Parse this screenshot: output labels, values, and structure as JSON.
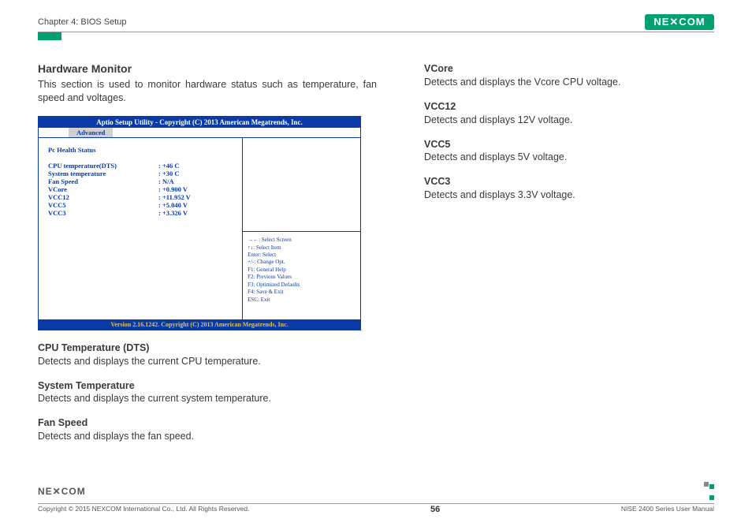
{
  "header": {
    "chapter": "Chapter 4: BIOS Setup",
    "brand": "NEXCOM"
  },
  "section": {
    "title": "Hardware Monitor",
    "intro": "This section is used to monitor hardware status such as temperature, fan speed and voltages."
  },
  "bios": {
    "title": "Aptio Setup Utility - Copyright (C) 2013 American Megatrends, Inc.",
    "tab": "Advanced",
    "heading": "Pc Health Status",
    "rows": [
      {
        "label": "CPU temperature(DTS)",
        "value": ":  +46 C"
      },
      {
        "label": "System temperature",
        "value": ":  +30 C"
      },
      {
        "label": "Fan Speed",
        "value": ":  N/A"
      },
      {
        "label": "VCore",
        "value": ":  +0.900 V"
      },
      {
        "label": "VCC12",
        "value": ":  +11.952 V"
      },
      {
        "label": "VCC5",
        "value": ":  +5.040 V"
      },
      {
        "label": "VCC3",
        "value": ":  +3.326 V"
      }
    ],
    "help": [
      "→←: Select Screen",
      "↑↓: Select Item",
      "Enter: Select",
      "+/-: Change Opt.",
      "F1: General Help",
      "F2: Previous Values",
      "F3: Optimized Defaults",
      "F4: Save & Exit",
      "ESC: Exit"
    ],
    "footer": "Version 2.16.1242. Copyright (C) 2013 American Megatrends, Inc."
  },
  "defs_left": [
    {
      "term": "CPU Temperature (DTS)",
      "desc": "Detects and displays the current CPU temperature."
    },
    {
      "term": "System Temperature",
      "desc": "Detects and displays the current system temperature."
    },
    {
      "term": "Fan Speed",
      "desc": "Detects and displays the fan speed."
    }
  ],
  "defs_right": [
    {
      "term": "VCore",
      "desc": "Detects and displays the Vcore CPU voltage."
    },
    {
      "term": "VCC12",
      "desc": "Detects and displays 12V voltage."
    },
    {
      "term": "VCC5",
      "desc": "Detects and displays 5V voltage."
    },
    {
      "term": "VCC3",
      "desc": "Detects and displays 3.3V voltage."
    }
  ],
  "footer": {
    "copyright": "Copyright © 2015 NEXCOM International Co., Ltd. All Rights Reserved.",
    "page": "56",
    "manual": "NISE 2400 Series User Manual",
    "brand": "NEXCOM"
  }
}
